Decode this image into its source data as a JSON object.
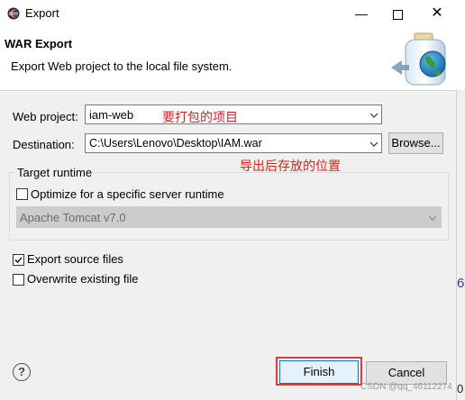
{
  "window": {
    "title": "Export",
    "minimize": "—",
    "close": "✕"
  },
  "banner": {
    "title": "WAR Export",
    "description": "Export Web project to the local file system."
  },
  "form": {
    "web_project_label": "Web project:",
    "web_project_value": "iam-web",
    "web_project_annotation": "要打包的项目",
    "destination_label": "Destination:",
    "destination_value": "C:\\Users\\Lenovo\\Desktop\\IAM.war",
    "destination_annotation": "导出后存放的位置",
    "browse_label": "Browse..."
  },
  "target_runtime": {
    "group_title": "Target runtime",
    "optimize_label": "Optimize for a specific server runtime",
    "optimize_checked": false,
    "runtime_value": "Apache Tomcat v7.0"
  },
  "options": {
    "export_source_label": "Export source files",
    "export_source_checked": true,
    "overwrite_label": "Overwrite existing file",
    "overwrite_checked": false
  },
  "footer": {
    "help": "?",
    "finish_label": "Finish",
    "cancel_label": "Cancel"
  },
  "watermark": "CSDN @qq_46112274",
  "edge_text": {
    "top": "6",
    "bottom": "0"
  },
  "colors": {
    "annotation": "#e02020",
    "highlight": "#e53935",
    "focus_border": "#0078d7"
  }
}
